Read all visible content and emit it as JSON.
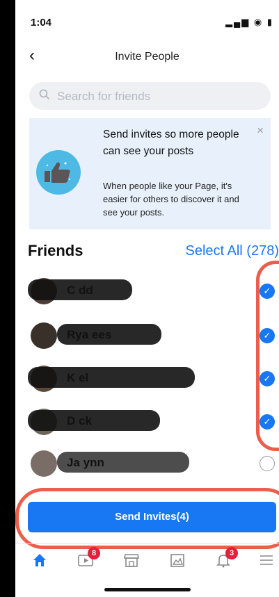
{
  "status_bar": {
    "time": "1:04",
    "icons": "▂▄▆ ◉ ▮"
  },
  "header": {
    "back_glyph": "‹",
    "title": "Invite People"
  },
  "search": {
    "placeholder": "Search for friends",
    "value": ""
  },
  "banner": {
    "headline": "Send invites so more people can see your posts",
    "body": "When people like your Page, it's easier for others to discover it and see your posts.",
    "close_glyph": "×",
    "icon": "thumbs-up-icon"
  },
  "friends": {
    "title": "Friends",
    "select_all_label": "Select All (278)",
    "items": [
      {
        "name": "C                dd",
        "selected": true
      },
      {
        "name": "Rya    ees",
        "selected": true
      },
      {
        "name": "K                     el",
        "selected": true
      },
      {
        "name": "D          ck",
        "selected": true
      },
      {
        "name": "Ja           ynn",
        "selected": false
      }
    ]
  },
  "send_button": {
    "label": "Send Invites(4)"
  },
  "tabbar": {
    "tabs": [
      {
        "icon": "home-icon",
        "badge": ""
      },
      {
        "icon": "video-icon",
        "badge": "8"
      },
      {
        "icon": "marketplace-icon",
        "badge": ""
      },
      {
        "icon": "pages-icon",
        "badge": ""
      },
      {
        "icon": "bell-icon",
        "badge": "3"
      },
      {
        "icon": "menu-icon",
        "badge": ""
      }
    ]
  },
  "colors": {
    "accent": "#1877f2",
    "annotation": "#e8432c",
    "badge": "#e41e3f"
  }
}
